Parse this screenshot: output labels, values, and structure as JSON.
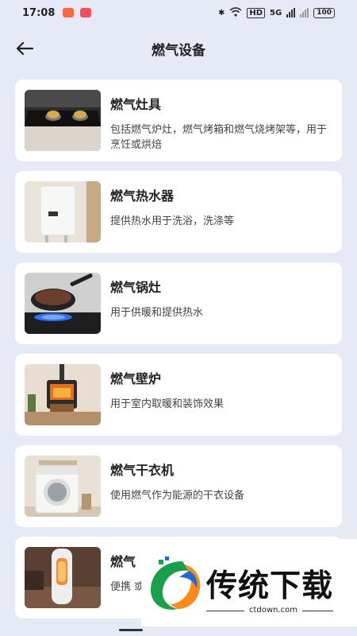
{
  "status": {
    "time": "17:08",
    "hd": "HD",
    "net": "5G",
    "battery": "100"
  },
  "header": {
    "title": "燃气设备",
    "back_icon": "arrow-left-icon"
  },
  "items": [
    {
      "title": "燃气灶具",
      "desc": "包括燃气炉灶，燃气烤箱和燃气烧烤架等，用于烹饪或烘焙",
      "image": "gas-stove-image"
    },
    {
      "title": "燃气热水器",
      "desc": "提供热水用于洗浴，洗涤等",
      "image": "water-heater-image"
    },
    {
      "title": "燃气锅灶",
      "desc": "用于供暖和提供热水",
      "image": "pan-on-burner-image"
    },
    {
      "title": "燃气壁炉",
      "desc": "用于室内取暖和装饰效果",
      "image": "fireplace-image"
    },
    {
      "title": "燃气干衣机",
      "desc": "使用燃气作为能源的干衣设备",
      "image": "dryer-image"
    },
    {
      "title": "燃气",
      "desc": "便携 或者",
      "image": "portable-heater-image"
    }
  ],
  "watermark": {
    "brand": "传统下载",
    "url": "ctdown.com"
  },
  "colors": {
    "background": "#e6eaf6",
    "card": "#ffffff",
    "title": "#222222",
    "desc": "#444444"
  }
}
